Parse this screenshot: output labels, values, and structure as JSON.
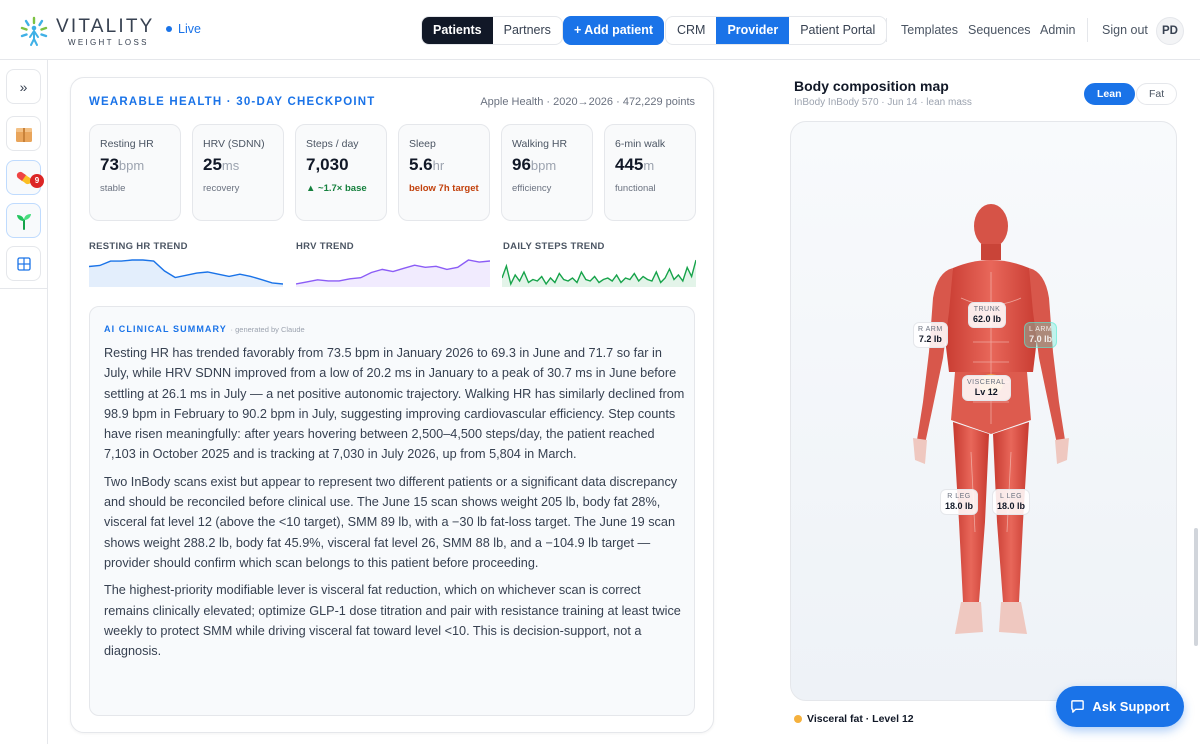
{
  "brand": {
    "name": "VITALITY",
    "tagline": "WEIGHT LOSS",
    "status": "Live"
  },
  "nav": {
    "view_tabs": [
      {
        "label": "Patients",
        "active": true
      },
      {
        "label": "Partners",
        "active": false
      }
    ],
    "add_patient": "+ Add patient",
    "mode_tabs": [
      {
        "label": "CRM",
        "active": false
      },
      {
        "label": "Provider",
        "active": true
      },
      {
        "label": "Patient Portal",
        "active": false
      }
    ],
    "links": [
      "Templates",
      "Sequences",
      "Admin"
    ],
    "sign_out": "Sign out",
    "avatar_initials": "PD"
  },
  "rail": {
    "expand_icon": "chevrons-right-icon",
    "items": [
      {
        "icon": "package-icon",
        "badge": "9"
      },
      {
        "icon": "pill-icon"
      },
      {
        "icon": "sprout-icon"
      },
      {
        "icon": "grid-icon"
      }
    ]
  },
  "wearable": {
    "title": "WEARABLE HEALTH · 30-DAY CHECKPOINT",
    "meta": "Apple Health · 2020→2026 · 472,229 points",
    "metrics": [
      {
        "label": "Resting HR",
        "value": "73",
        "unit": "bpm",
        "sub": "stable",
        "tone": "neutral"
      },
      {
        "label": "HRV (SDNN)",
        "value": "25",
        "unit": "ms",
        "sub": "recovery",
        "tone": "neutral"
      },
      {
        "label": "Steps / day",
        "value": "7,030",
        "unit": "",
        "sub": "▲ ~1.7× base",
        "tone": "good"
      },
      {
        "label": "Sleep",
        "value": "5.6",
        "unit": "hr",
        "sub": "below 7h target",
        "tone": "warn"
      },
      {
        "label": "Walking HR",
        "value": "96",
        "unit": "bpm",
        "sub": "efficiency",
        "tone": "neutral"
      },
      {
        "label": "6-min walk",
        "value": "445",
        "unit": "m",
        "sub": "functional",
        "tone": "neutral"
      }
    ],
    "trends": [
      {
        "label": "RESTING HR TREND",
        "color": "#1a73e8",
        "values": [
          22,
          23,
          27,
          27,
          28,
          28,
          27,
          18,
          12,
          14,
          16,
          17,
          15,
          13,
          15,
          13,
          10,
          7,
          6
        ]
      },
      {
        "label": "HRV TREND",
        "color": "#8b5cf6",
        "values": [
          3,
          5,
          7,
          6,
          6,
          8,
          9,
          14,
          17,
          15,
          18,
          21,
          19,
          20,
          17,
          19,
          26,
          24,
          25
        ]
      },
      {
        "label": "DAILY STEPS TREND",
        "color": "#16a34a",
        "values": [
          12,
          20,
          8,
          14,
          10,
          16,
          9,
          11,
          10,
          13,
          8,
          12,
          9,
          15,
          11,
          10,
          12,
          9,
          16,
          11,
          10,
          13,
          9,
          11,
          12,
          10,
          14,
          9,
          12,
          11,
          15,
          10,
          13,
          11,
          10,
          16,
          9,
          12,
          18,
          11,
          14,
          10,
          19,
          13,
          24
        ]
      }
    ]
  },
  "summary": {
    "title": "AI CLINICAL SUMMARY",
    "generated_by": "· generated by Claude",
    "paragraphs": [
      "Resting HR has trended favorably from 73.5 bpm in January 2026 to 69.3 in June and 71.7 so far in July, while HRV SDNN improved from a low of 20.2 ms in January to a peak of 30.7 ms in June before settling at 26.1 ms in July — a net positive autonomic trajectory. Walking HR has similarly declined from 98.9 bpm in February to 90.2 bpm in July, suggesting improving cardiovascular efficiency. Step counts have risen meaningfully: after years hovering between 2,500–4,500 steps/day, the patient reached 7,103 in October 2025 and is tracking at 7,030 in July 2026, up from 5,804 in March.",
      "Two InBody scans exist but appear to represent two different patients or a significant data discrepancy and should be reconciled before clinical use. The June 15 scan shows weight 205 lb, body fat 28%, visceral fat level 12 (above the <10 target), SMM 89 lb, with a −30 lb fat-loss target. The June 19 scan shows weight 288.2 lb, body fat 45.9%, visceral fat level 26, SMM 88 lb, and a −104.9 lb target — provider should confirm which scan belongs to this patient before proceeding.",
      "The highest-priority modifiable lever is visceral fat reduction, which on whichever scan is correct remains clinically elevated; optimize GLP-1 dose titration and pair with resistance training at least twice weekly to protect SMM while driving visceral fat toward level <10. This is decision-support, not a diagnosis."
    ]
  },
  "body_map": {
    "title": "Body composition map",
    "subtitle": "InBody InBody 570 · Jun 14 · lean mass",
    "toggles": [
      {
        "label": "Lean",
        "active": true
      },
      {
        "label": "Fat",
        "active": false
      }
    ],
    "regions": {
      "trunk": {
        "label": "TRUNK",
        "value": "62.0 lb"
      },
      "r_arm": {
        "label": "R ARM",
        "value": "7.2 lb"
      },
      "l_arm": {
        "label": "L ARM",
        "value": "7.0 lb"
      },
      "visceral": {
        "label": "VISCERAL",
        "value": "Lv 12"
      },
      "r_leg": {
        "label": "R LEG",
        "value": "18.0 lb"
      },
      "l_leg": {
        "label": "L LEG",
        "value": "18.0 lb"
      }
    },
    "legend": "Visceral fat · Level 12",
    "legend_color": "#f5b13d"
  },
  "support_button": "Ask Support"
}
